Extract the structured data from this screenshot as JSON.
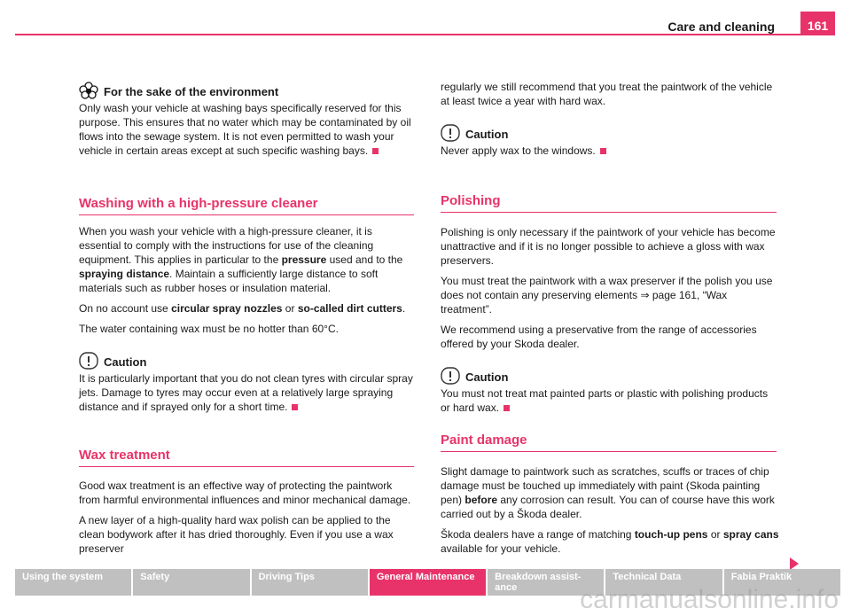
{
  "header": {
    "title": "Care and cleaning",
    "page_number": "161"
  },
  "left": {
    "env": {
      "title": "For the sake of the environment",
      "text": "Only wash your vehicle at washing bays specifically reserved for this purpose. This ensures that no water which may be contaminated by oil flows into the sewage system. It is not even permitted to wash your vehicle in certain areas except at such specific washing bays."
    },
    "hp": {
      "heading": "Washing with a high-pressure cleaner",
      "p1a": "When you wash your vehicle with a high-pressure cleaner, it is essential to comply with the instructions for use of the cleaning equipment. This applies in particular to the ",
      "p1b": "pressure",
      "p1c": " used and to the ",
      "p1d": "spraying distance",
      "p1e": ". Maintain a sufficiently large distance to soft materials such as rubber hoses or insulation material.",
      "p2a": "On no account use ",
      "p2b": "circular spray nozzles",
      "p2c": " or ",
      "p2d": "so-called dirt cutters",
      "p2e": ".",
      "p3": "The water containing wax must be no hotter than 60°C.",
      "caution_title": "Caution",
      "caution_text": "It is particularly important that you do not clean tyres with circular spray jets. Damage to tyres may occur even at a relatively large spraying distance and if sprayed only for a short time."
    },
    "wax": {
      "heading": "Wax treatment",
      "p1": "Good wax treatment is an effective way of protecting the paintwork from harmful environmental influences and minor mechanical damage.",
      "p2": "A new layer of a high-quality hard wax polish can be applied to the clean bodywork after it has dried thoroughly. Even if you use a wax preserver"
    }
  },
  "right": {
    "wax_cont": "regularly we still recommend that you treat the paintwork of the vehicle at least twice a year with hard wax.",
    "caution1_title": "Caution",
    "caution1_text": "Never apply wax to the windows.",
    "pol": {
      "heading": "Polishing",
      "p1": "Polishing is only necessary if the paintwork of your vehicle has become unattractive and if it is no longer possible to achieve a gloss with wax preservers.",
      "p2": "You must treat the paintwork with a wax preserver if the polish you use does not contain any preserving elements ⇒ page 161, “Wax treatment”.",
      "p3": "We recommend using a preservative from the range of accessories offered by your Skoda dealer.",
      "caution_title": "Caution",
      "caution_text": "You must not treat mat painted parts or plastic with polishing products or hard wax."
    },
    "paint": {
      "heading": "Paint damage",
      "p1a": "Slight damage to paintwork such as scratches, scuffs or traces of chip damage must be touched up immediately with paint (Skoda painting pen) ",
      "p1b": "before",
      "p1c": " any corrosion can result. You can of course have this work carried out by a Škoda dealer.",
      "p2a": "Škoda dealers have a range of matching ",
      "p2b": "touch-up pens",
      "p2c": " or ",
      "p2d": "spray cans",
      "p2e": " available for your vehicle."
    }
  },
  "footer": {
    "tabs": [
      "Using the system",
      "Safety",
      "Driving Tips",
      "General Maintenance",
      "Breakdown assist-\nance",
      "Technical Data",
      "Fabia Praktik"
    ],
    "active": "General Maintenance",
    "watermark": "carmanualsonline.info"
  },
  "colors": {
    "accent": "#e8336a",
    "tab": "#c0c0c0"
  }
}
